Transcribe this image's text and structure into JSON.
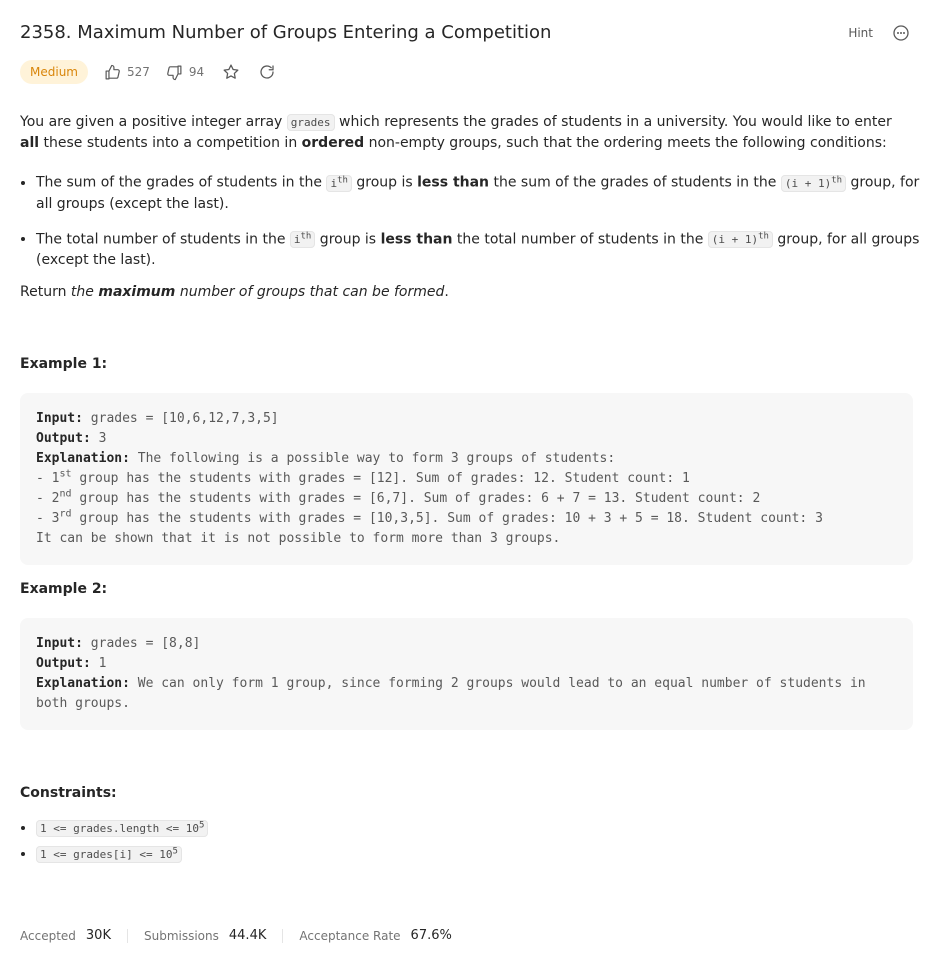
{
  "problem": {
    "title": "2358. Maximum Number of Groups Entering a Competition",
    "hint_label": "Hint",
    "difficulty": "Medium",
    "likes": "527",
    "dislikes": "94"
  },
  "description": {
    "intro_1": "You are given a positive integer array ",
    "intro_code": "grades",
    "intro_2": " which represents the grades of students in a university. You would like to enter ",
    "intro_bold_1": "all",
    "intro_3": " these students into a competition in ",
    "intro_bold_2": "ordered",
    "intro_4": " non-empty groups, such that the ordering meets the following conditions:",
    "cond1_a": "The sum of the grades of students in the ",
    "cond_i": "i",
    "cond_th": "th",
    "cond1_b": " group is ",
    "less_than": "less than",
    "cond1_c": " the sum of the grades of students in the ",
    "cond_i1": "(i + 1)",
    "cond1_d": " group, for all groups (except the last).",
    "cond2_a": "The total number of students in the ",
    "cond2_b": " group is ",
    "cond2_c": " the total number of students in the ",
    "cond2_d": " group, for all groups (except the last).",
    "return_a": "Return ",
    "return_the": "the ",
    "return_bold": "maximum",
    "return_b": " number of groups that can be formed",
    "return_c": "."
  },
  "example1": {
    "heading": "Example 1:",
    "input_label": "Input:",
    "input": " grades = [10,6,12,7,3,5]",
    "output_label": "Output:",
    "output": " 3",
    "explanation_label": "Explanation:",
    "explanation": " The following is a possible way to form 3 groups of students:",
    "l1a": "- 1",
    "l1sup": "st",
    "l1b": " group has the students with grades = [12]. Sum of grades: 12. Student count: 1",
    "l2a": "- 2",
    "l2sup": "nd",
    "l2b": " group has the students with grades = [6,7]. Sum of grades: 6 + 7 = 13. Student count: 2",
    "l3a": "- 3",
    "l3sup": "rd",
    "l3b": " group has the students with grades = [10,3,5]. Sum of grades: 10 + 3 + 5 = 18. Student count: 3",
    "l4": "It can be shown that it is not possible to form more than 3 groups."
  },
  "example2": {
    "heading": "Example 2:",
    "input_label": "Input:",
    "input": " grades = [8,8]",
    "output_label": "Output:",
    "output": " 1",
    "explanation_label": "Explanation:",
    "explanation": " We can only form 1 group, since forming 2 groups would lead to an equal number of students in both groups."
  },
  "constraints": {
    "heading": "Constraints:",
    "c1": "1 <= grades.length <= 10",
    "c1_sup": "5",
    "c2": "1 <= grades[i] <= 10",
    "c2_sup": "5"
  },
  "stats": {
    "accepted_label": "Accepted",
    "accepted": "30K",
    "submissions_label": "Submissions",
    "submissions": "44.4K",
    "rate_label": "Acceptance Rate",
    "rate": "67.6%"
  },
  "colors": {
    "difficulty_bg": "#fff3d9",
    "difficulty_text": "#d9860b"
  },
  "icons": [
    "thumbs-up-icon",
    "thumbs-down-icon",
    "star-icon",
    "share-icon",
    "more-icon"
  ]
}
